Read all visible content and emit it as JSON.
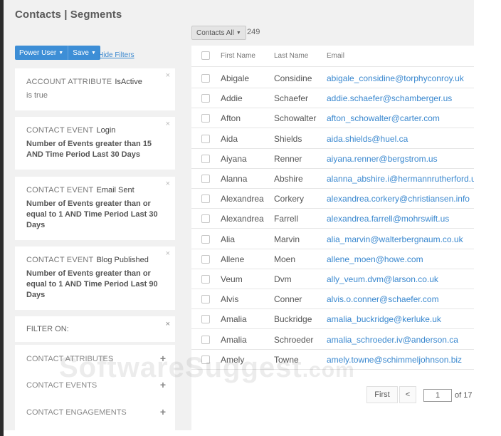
{
  "page": {
    "title": "Contacts | Segments"
  },
  "toolbar": {
    "contacts_dropdown": "Contacts All",
    "count": "249"
  },
  "buttons": {
    "power_user": "Power User",
    "save": "Save",
    "hide_filters": "Hide Filters"
  },
  "filters": [
    {
      "kind": "ACCOUNT ATTRIBUTE",
      "value": "IsActive",
      "desc": "is true"
    },
    {
      "kind": "CONTACT EVENT",
      "value": "Login",
      "line1": "Number of Events greater than 15",
      "line2": "AND Time Period Last 30 Days"
    },
    {
      "kind": "CONTACT EVENT",
      "value": "Email Sent",
      "line1": "Number of Events greater than or",
      "line2": "equal to 1 AND Time Period Last 30",
      "line3": "Days"
    },
    {
      "kind": "CONTACT EVENT",
      "value": "Blog Published",
      "line1": "Number of Events greater than or",
      "line2": "equal to 1 AND Time Period Last 90",
      "line3": "Days"
    }
  ],
  "filter_on": {
    "title": "FILTER ON:",
    "items": [
      "CONTACT ATTRIBUTES",
      "CONTACT EVENTS",
      "CONTACT ENGAGEMENTS"
    ]
  },
  "table": {
    "headers": [
      "First Name",
      "Last Name",
      "Email"
    ],
    "rows": [
      [
        "Abigale",
        "Considine",
        "abigale_considine@torphyconroy.uk"
      ],
      [
        "Addie",
        "Schaefer",
        "addie.schaefer@schamberger.us"
      ],
      [
        "Afton",
        "Schowalter",
        "afton_schowalter@carter.com"
      ],
      [
        "Aida",
        "Shields",
        "aida.shields@huel.ca"
      ],
      [
        "Aiyana",
        "Renner",
        "aiyana.renner@bergstrom.us"
      ],
      [
        "Alanna",
        "Abshire",
        "alanna_abshire.i@hermannrutherford.uk"
      ],
      [
        "Alexandrea",
        "Corkery",
        "alexandrea.corkery@christiansen.info"
      ],
      [
        "Alexandrea",
        "Farrell",
        "alexandrea.farrell@mohrswift.us"
      ],
      [
        "Alia",
        "Marvin",
        "alia_marvin@walterbergnaum.co.uk"
      ],
      [
        "Allene",
        "Moen",
        "allene_moen@howe.com"
      ],
      [
        "Veum",
        "Dvm",
        "ally_veum.dvm@larson.co.uk"
      ],
      [
        "Alvis",
        "Conner",
        "alvis.o.conner@schaefer.com"
      ],
      [
        "Amalia",
        "Buckridge",
        "amalia_buckridge@kerluke.uk"
      ],
      [
        "Amalia",
        "Schroeder",
        "amalia_schroeder.iv@anderson.ca"
      ],
      [
        "Amely",
        "Towne",
        "amely.towne@schimmeljohnson.biz"
      ]
    ]
  },
  "pagination": {
    "first": "First",
    "prev": "<",
    "current": "1",
    "of_total": "of 17"
  },
  "watermark": {
    "main": "SoftwareSuggest",
    "suffix": ".com"
  }
}
